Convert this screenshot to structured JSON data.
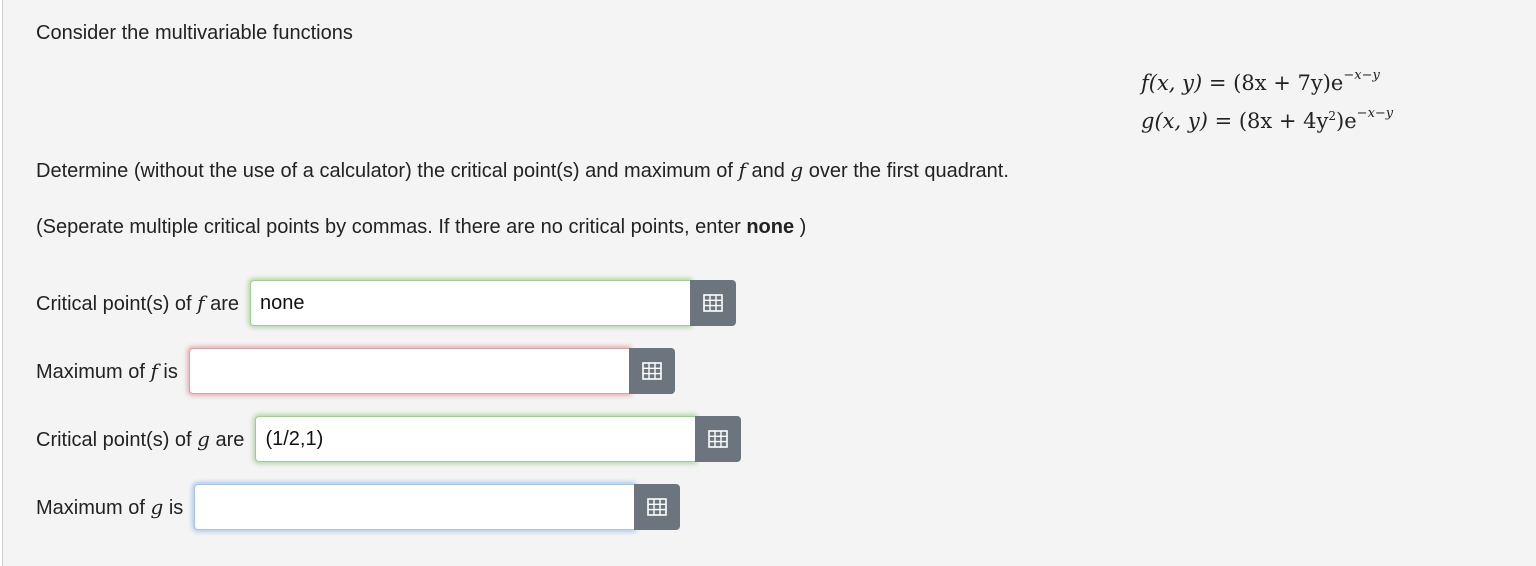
{
  "intro": {
    "text": "Consider the multivariable functions"
  },
  "equations": {
    "f_lhs": "f(x, y)",
    "f_rhs_main": " = (8x + 7y)e",
    "f_exp": "−x−y",
    "g_lhs": "g(x, y)",
    "g_rhs_main_a": " = (8x + 4y",
    "g_square": "2",
    "g_rhs_main_b": ")e",
    "g_exp": "−x−y"
  },
  "instructions": {
    "part1": "Determine (without the use of a calculator) the critical point(s) and maximum of ",
    "f_sym": "f",
    "and": " and ",
    "g_sym": "g",
    "part2": " over the first quadrant."
  },
  "note": {
    "prefix": "(Seperate multiple critical points by commas. If there are no critical points, enter ",
    "keyword": "none",
    "suffix": " )"
  },
  "answers": [
    {
      "label_pre": "Critical point(s) of ",
      "symbol": "f",
      "label_post": " are",
      "value": "none",
      "status": "green"
    },
    {
      "label_pre": "Maximum of ",
      "symbol": "f",
      "label_post": " is",
      "value": "",
      "status": "red"
    },
    {
      "label_pre": "Critical point(s) of ",
      "symbol": "g",
      "label_post": " are",
      "value": "(1/2,1)",
      "status": "green"
    },
    {
      "label_pre": "Maximum of ",
      "symbol": "g",
      "label_post": " is",
      "value": "",
      "status": "blue"
    }
  ],
  "icons": {
    "matrix_button": "matrix-grid-icon"
  },
  "colors": {
    "background": "#f4f4f4",
    "button": "#6c757d",
    "correct_glow": "#6eb45a",
    "incorrect_glow": "#d26464",
    "focus_glow": "#6ea0e6"
  }
}
